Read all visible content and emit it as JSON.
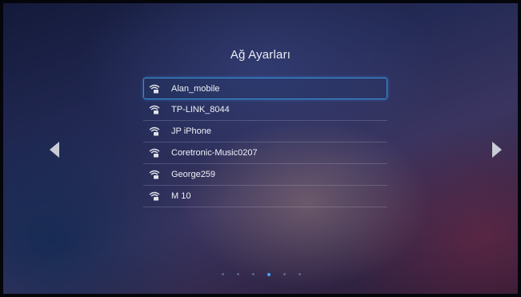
{
  "header": {
    "title": "Ağ Ayarları"
  },
  "networks": [
    {
      "ssid": "Alan_mobile",
      "icon": "wifi-secured-icon",
      "selected": true
    },
    {
      "ssid": "TP-LINK_8044",
      "icon": "wifi-secured-icon",
      "selected": false
    },
    {
      "ssid": "JP iPhone",
      "icon": "wifi-secured-icon",
      "selected": false
    },
    {
      "ssid": "Coretronic-Music0207",
      "icon": "wifi-secured-icon",
      "selected": false
    },
    {
      "ssid": "George259",
      "icon": "wifi-secured-icon",
      "selected": false
    },
    {
      "ssid": "M 10",
      "icon": "wifi-secured-icon",
      "selected": false
    }
  ],
  "navigation": {
    "left_icon": "chevron-left-icon",
    "right_icon": "chevron-right-icon"
  },
  "pagination": {
    "total": 6,
    "current": 4
  },
  "colors": {
    "accent": "#3b8fd9",
    "text": "#eef0f6"
  }
}
